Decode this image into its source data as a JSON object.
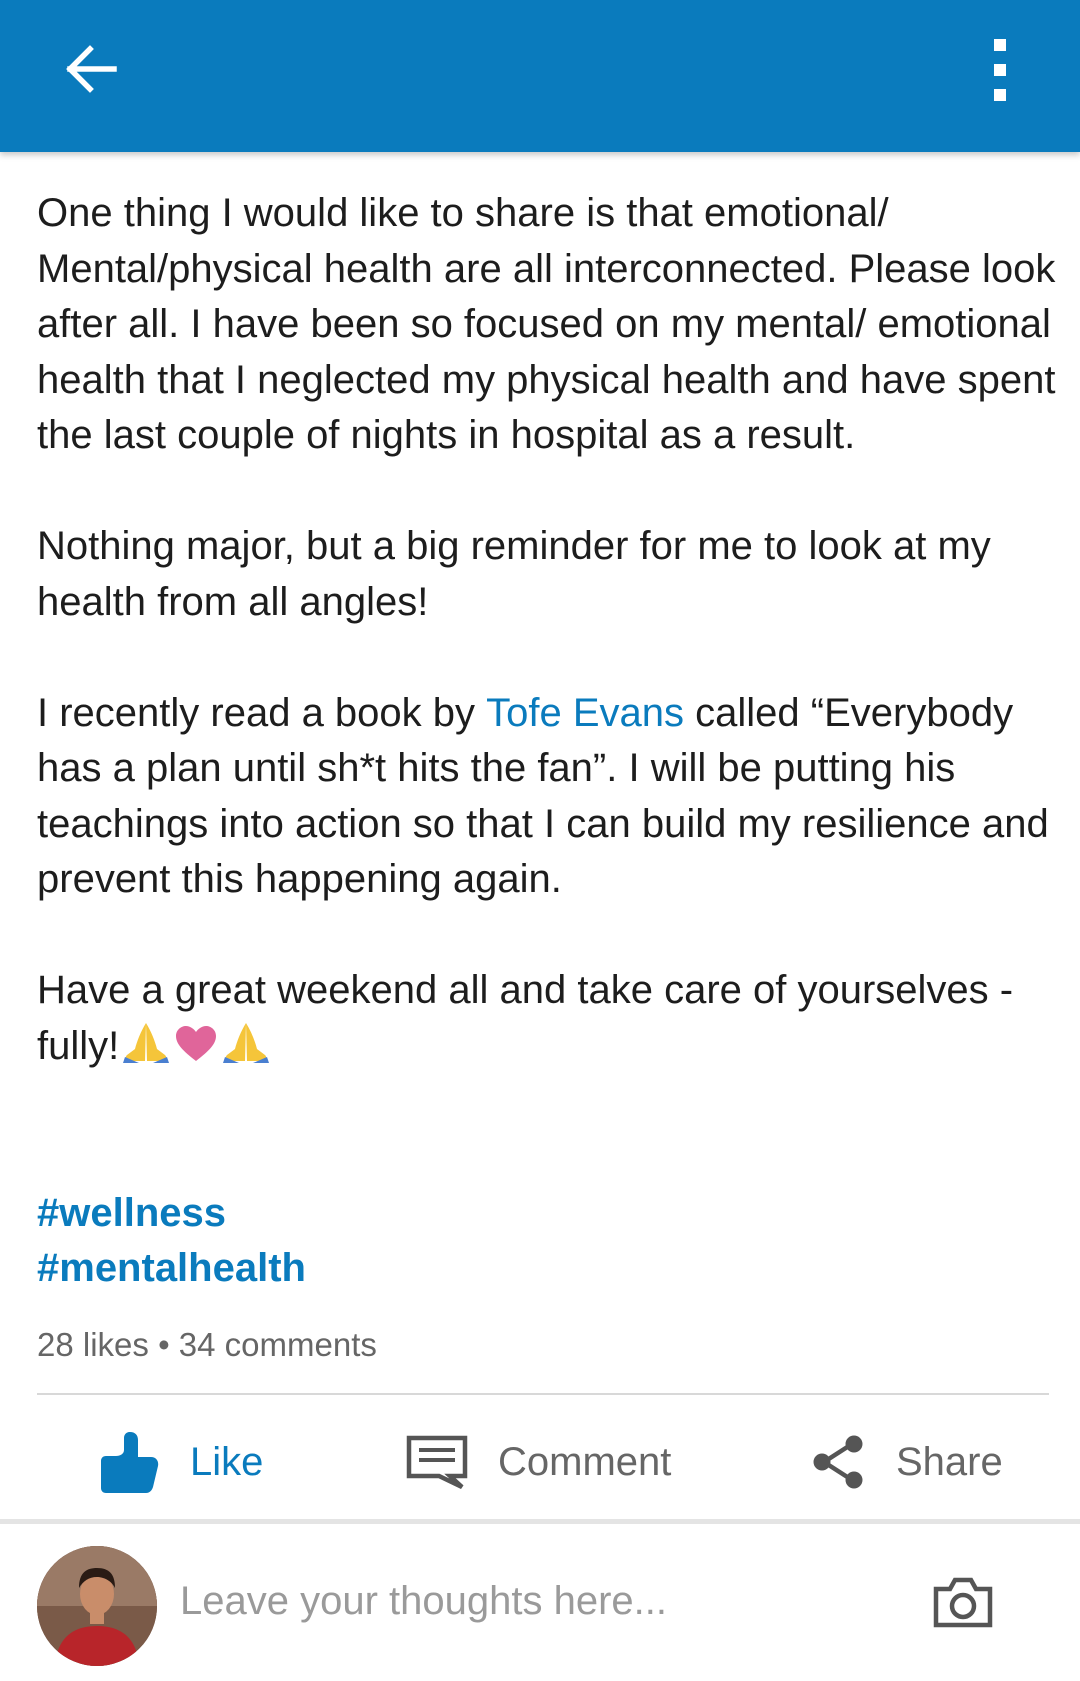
{
  "post": {
    "paragraphs": {
      "p1": "One thing I would like to share is that emotional/ Mental/physical health are all interconnected.  Please look after all.  I have been so focused on my mental/ emotional health that I neglected my physical health and have spent the last couple of nights in hospital as a result.",
      "p2": "Nothing major, but a big reminder for me to look at my health from all angles!",
      "p3_before": "I recently read a book by ",
      "p3_mention": "Tofe Evans",
      "p3_after": " called “Everybody has a plan until sh*t hits the fan”.  I will be putting his teachings into action so that I can build my resilience and prevent this happening again.",
      "p4": "Have a great weekend all and take care of yourselves - fully!"
    },
    "emojis": [
      "praying-hands",
      "heart",
      "praying-hands"
    ],
    "hashtags": [
      "#wellness",
      "#mentalhealth"
    ],
    "stats": {
      "likes": "28 likes",
      "separator": "•",
      "comments": "34 comments"
    }
  },
  "actions": {
    "like": "Like",
    "comment": "Comment",
    "share": "Share"
  },
  "composer": {
    "placeholder": "Leave your thoughts here..."
  },
  "colors": {
    "brand": "#0a7bbd",
    "text": "#1d1d1d",
    "muted": "#666666"
  },
  "icons": {
    "back": "arrow-left-icon",
    "more": "more-vertical-icon",
    "like": "thumbs-up-icon",
    "comment": "comment-icon",
    "share": "share-icon",
    "camera": "camera-icon"
  }
}
